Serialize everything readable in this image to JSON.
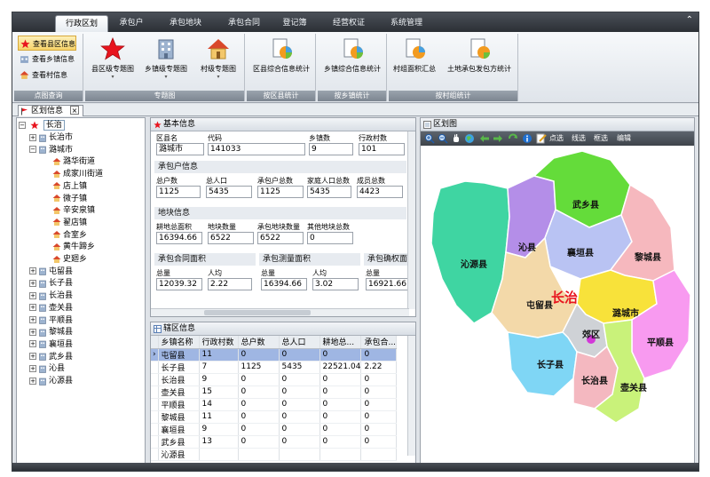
{
  "ribbon": {
    "tabs": [
      "行政区划",
      "承包户",
      "承包地块",
      "承包合同",
      "登记簿",
      "经营权证",
      "系统管理"
    ],
    "active_tab": "行政区划",
    "groups": {
      "view": {
        "label": "点图查询",
        "items": [
          "查看县区信息",
          "查看乡镇信息",
          "查看村信息"
        ]
      },
      "thematic": {
        "label": "专题图",
        "items": [
          "县区级专题图",
          "乡镇级专题图",
          "村级专题图"
        ]
      },
      "county_stats": {
        "label": "按区县统计",
        "items": [
          "区县综合信息统计"
        ]
      },
      "town_stats": {
        "label": "按乡镇统计",
        "items": [
          "乡镇综合信息统计"
        ]
      },
      "group_stats": {
        "label": "按村组统计",
        "items": [
          "村组面积汇总",
          "土地承包发包方统计"
        ]
      }
    }
  },
  "doc_tab": {
    "label": "区划信息",
    "close": "×"
  },
  "tree": {
    "root": "长治",
    "nodes": [
      {
        "label": "长治市",
        "level": 1,
        "toggle": "+"
      },
      {
        "label": "潞城市",
        "level": 1,
        "toggle": "−"
      },
      {
        "label": "潞华街道",
        "level": 2
      },
      {
        "label": "成家川街道",
        "level": 2
      },
      {
        "label": "店上镇",
        "level": 2
      },
      {
        "label": "微子镇",
        "level": 2
      },
      {
        "label": "辛安泉镇",
        "level": 2
      },
      {
        "label": "翟店镇",
        "level": 2
      },
      {
        "label": "合室乡",
        "level": 2
      },
      {
        "label": "黄牛蹄乡",
        "level": 2
      },
      {
        "label": "史廻乡",
        "level": 2
      },
      {
        "label": "屯留县",
        "level": 1,
        "toggle": "+"
      },
      {
        "label": "长子县",
        "level": 1,
        "toggle": "+"
      },
      {
        "label": "长治县",
        "level": 1,
        "toggle": "+"
      },
      {
        "label": "壶关县",
        "level": 1,
        "toggle": "+"
      },
      {
        "label": "平顺县",
        "level": 1,
        "toggle": "+"
      },
      {
        "label": "黎城县",
        "level": 1,
        "toggle": "+"
      },
      {
        "label": "襄垣县",
        "level": 1,
        "toggle": "+"
      },
      {
        "label": "武乡县",
        "level": 1,
        "toggle": "+"
      },
      {
        "label": "沁县",
        "level": 1,
        "toggle": "+"
      },
      {
        "label": "沁源县",
        "level": 1,
        "toggle": "+"
      }
    ]
  },
  "basic": {
    "title": "基本信息",
    "county_name": {
      "label": "区县名",
      "value": "潞城市"
    },
    "code": {
      "label": "代码",
      "value": "141033"
    },
    "town_count": {
      "label": "乡镇数",
      "value": "9"
    },
    "village_count": {
      "label": "行政村数",
      "value": "101"
    },
    "household_section": "承包户信息",
    "households": {
      "label": "总户数",
      "value": "1125"
    },
    "population": {
      "label": "总人口",
      "value": "5435"
    },
    "contract_households": {
      "label": "承包户总数",
      "value": "1125"
    },
    "family_population": {
      "label": "家庭人口总数",
      "value": "5435"
    },
    "members": {
      "label": "成员总数",
      "value": "4423"
    },
    "plot_section": "地块信息",
    "farmland_area": {
      "label": "耕地总面积",
      "value": "16394.66"
    },
    "plot_count": {
      "label": "地块数量",
      "value": "6522"
    },
    "contract_plot_count": {
      "label": "承包地块数量",
      "value": "6522"
    },
    "other_plot_count": {
      "label": "其他地块总数",
      "value": "0"
    },
    "contract_area_section": "承包合同面积",
    "contract_total": {
      "label": "总量",
      "value": "12039.32"
    },
    "contract_percap": {
      "label": "人均",
      "value": "2.22"
    },
    "measured_area_section": "承包测量面积",
    "measured_total": {
      "label": "总量",
      "value": "16394.66"
    },
    "measured_percap": {
      "label": "人均",
      "value": "3.02"
    },
    "confirmed_area_section": "承包确权面",
    "confirmed_total": {
      "label": "总量",
      "value": "16921.66"
    }
  },
  "grid": {
    "title": "辖区信息",
    "columns": [
      "乡镇名称",
      "行政村数",
      "总户数",
      "总人口",
      "耕地总...",
      "承包合..."
    ],
    "rows": [
      [
        "屯留县",
        "11",
        "0",
        "0",
        "0",
        "0"
      ],
      [
        "长子县",
        "7",
        "1125",
        "5435",
        "22521.04",
        "2.22"
      ],
      [
        "长治县",
        "9",
        "0",
        "0",
        "0",
        "0"
      ],
      [
        "壶关县",
        "15",
        "0",
        "0",
        "0",
        "0"
      ],
      [
        "平顺县",
        "14",
        "0",
        "0",
        "0",
        "0"
      ],
      [
        "黎城县",
        "11",
        "0",
        "0",
        "0",
        "0"
      ],
      [
        "襄垣县",
        "9",
        "0",
        "0",
        "0",
        "0"
      ],
      [
        "武乡县",
        "13",
        "0",
        "0",
        "0",
        "0"
      ],
      [
        "沁源县",
        "",
        "",
        "",
        "",
        ""
      ]
    ],
    "selected_indicator": "›"
  },
  "map": {
    "title": "区划图",
    "tools": {
      "select": "点选",
      "line_select": "线选",
      "box_select": "框选",
      "edit": "编辑"
    },
    "regions": [
      "沁源县",
      "沁县",
      "武乡县",
      "襄垣县",
      "黎城县",
      "屯留县",
      "潞城市",
      "郊区",
      "长子县",
      "长治县",
      "平顺县",
      "壶关县"
    ],
    "city_label": "长治",
    "colors": {
      "accent_red": "#e8141e",
      "selection_blue": "#9fb6e3"
    }
  }
}
